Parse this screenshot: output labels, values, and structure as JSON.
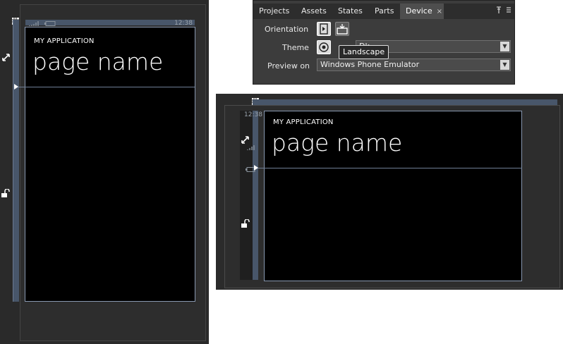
{
  "portrait": {
    "status_time": "12:38",
    "app_title": "MY APPLICATION",
    "page_name": "page name"
  },
  "device_panel": {
    "tabs": [
      {
        "label": "Projects"
      },
      {
        "label": "Assets"
      },
      {
        "label": "States"
      },
      {
        "label": "Parts"
      },
      {
        "label": "Device",
        "active": true
      }
    ],
    "close_glyph": "×",
    "orientation_label": "Orientation",
    "theme_label": "Theme",
    "theme_value": "Dk",
    "preview_label": "Preview on",
    "preview_value": "Windows Phone Emulator",
    "tooltip": "Landscape"
  },
  "landscape": {
    "status_time": "12:38",
    "app_title": "MY APPLICATION",
    "page_name": "page name"
  },
  "colors": {
    "rail": "#48566a",
    "screen_border": "#8898b0",
    "panel_bg": "#3c3c3c"
  },
  "icons": [
    "grid-icon",
    "resize-icon",
    "unlock-icon",
    "signal-icon",
    "battery-icon",
    "pin-icon",
    "menu-icon",
    "portrait-orientation-icon",
    "landscape-orientation-icon",
    "theme-icon"
  ]
}
